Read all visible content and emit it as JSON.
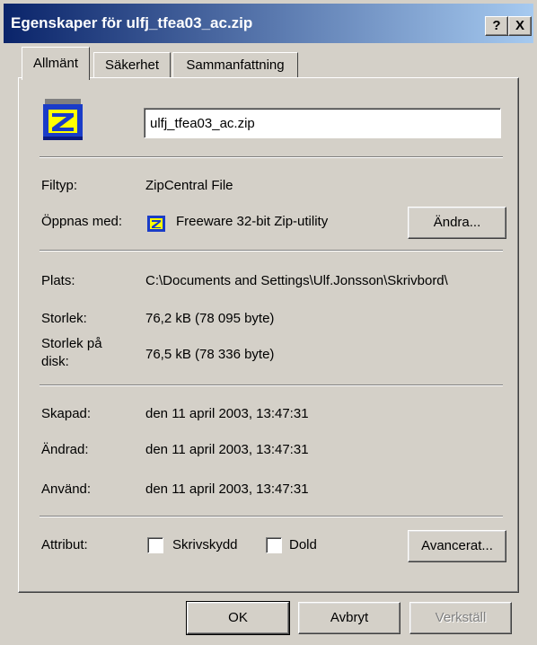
{
  "window": {
    "title": "Egenskaper för ulfj_tfea03_ac.zip",
    "help_label": "?",
    "close_label": "X"
  },
  "tabs": [
    "Allmänt",
    "Säkerhet",
    "Sammanfattning"
  ],
  "file": {
    "icon": "zipcentral-file-icon",
    "name": "ulfj_tfea03_ac.zip"
  },
  "info": {
    "type_label": "Filtyp:",
    "type_value": "ZipCentral File",
    "opens_label": "Öppnas med:",
    "opens_value": "Freeware 32-bit Zip-utility",
    "change_label": "Ändra...",
    "location_label": "Plats:",
    "location_value": "C:\\Documents and Settings\\Ulf.Jonsson\\Skrivbord\\",
    "size_label": "Storlek:",
    "size_value": "76,2 kB (78 095 byte)",
    "size_on_disk_label_1": "Storlek på",
    "size_on_disk_label_2": "disk:",
    "size_on_disk_value": "76,5 kB (78 336 byte)",
    "created_label": "Skapad:",
    "created_value": "den 11 april 2003, 13:47:31",
    "modified_label": "Ändrad:",
    "modified_value": "den 11 april 2003, 13:47:31",
    "accessed_label": "Använd:",
    "accessed_value": "den 11 april 2003, 13:47:31"
  },
  "attributes": {
    "label": "Attribut:",
    "readonly_label": "Skrivskydd",
    "readonly_checked": false,
    "hidden_label": "Dold",
    "hidden_checked": false,
    "advanced_label": "Avancerat..."
  },
  "footer": {
    "ok_label": "OK",
    "cancel_label": "Avbryt",
    "apply_label": "Verkställ"
  },
  "colors": {
    "titlebar_start": "#0a246a",
    "titlebar_end": "#a6caf0",
    "face": "#d4d0c8"
  }
}
